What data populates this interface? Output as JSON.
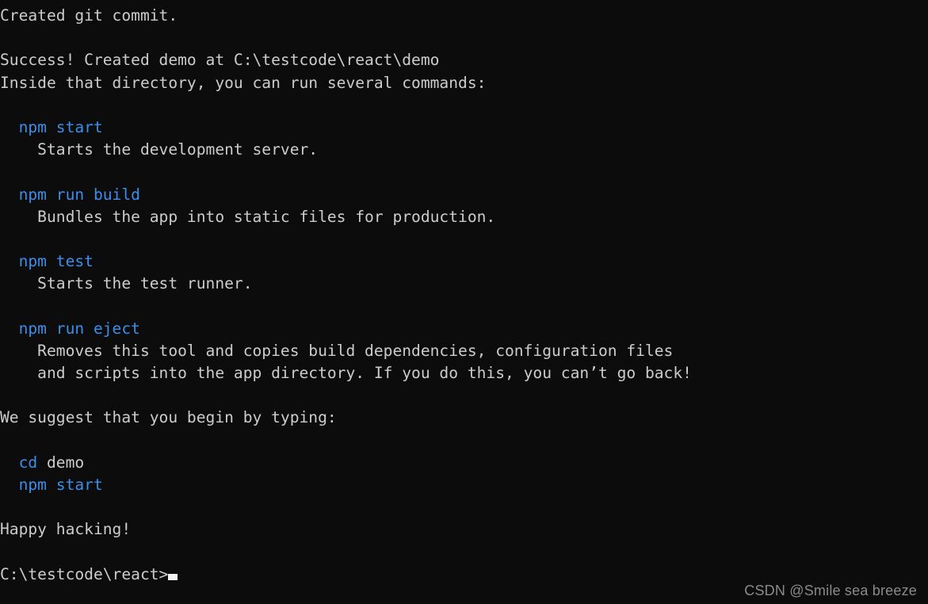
{
  "terminal": {
    "background_color": "#0c0c0c",
    "text_color": "#cccccc",
    "command_color": "#3b8eea",
    "cursor": "▃",
    "lines": [
      {
        "id": "line-created-git-commit",
        "segments": [
          {
            "kind": "out",
            "text": "Created git commit."
          }
        ]
      },
      {
        "id": "line-blank-1",
        "segments": [
          {
            "kind": "out",
            "text": ""
          }
        ]
      },
      {
        "id": "line-success-created",
        "segments": [
          {
            "kind": "out",
            "text": "Success! Created demo at C:\\testcode\\react\\demo"
          }
        ]
      },
      {
        "id": "line-inside-directory",
        "segments": [
          {
            "kind": "out",
            "text": "Inside that directory, you can run several commands:"
          }
        ]
      },
      {
        "id": "line-blank-2",
        "segments": [
          {
            "kind": "out",
            "text": ""
          }
        ]
      },
      {
        "id": "line-cmd-npm-start",
        "segments": [
          {
            "kind": "out",
            "text": "  "
          },
          {
            "kind": "cmd",
            "text": "npm start"
          }
        ]
      },
      {
        "id": "line-desc-npm-start",
        "segments": [
          {
            "kind": "out",
            "text": "    Starts the development server."
          }
        ]
      },
      {
        "id": "line-blank-3",
        "segments": [
          {
            "kind": "out",
            "text": ""
          }
        ]
      },
      {
        "id": "line-cmd-npm-run-build",
        "segments": [
          {
            "kind": "out",
            "text": "  "
          },
          {
            "kind": "cmd",
            "text": "npm run build"
          }
        ]
      },
      {
        "id": "line-desc-npm-run-build",
        "segments": [
          {
            "kind": "out",
            "text": "    Bundles the app into static files for production."
          }
        ]
      },
      {
        "id": "line-blank-4",
        "segments": [
          {
            "kind": "out",
            "text": ""
          }
        ]
      },
      {
        "id": "line-cmd-npm-test",
        "segments": [
          {
            "kind": "out",
            "text": "  "
          },
          {
            "kind": "cmd",
            "text": "npm test"
          }
        ]
      },
      {
        "id": "line-desc-npm-test",
        "segments": [
          {
            "kind": "out",
            "text": "    Starts the test runner."
          }
        ]
      },
      {
        "id": "line-blank-5",
        "segments": [
          {
            "kind": "out",
            "text": ""
          }
        ]
      },
      {
        "id": "line-cmd-npm-run-eject",
        "segments": [
          {
            "kind": "out",
            "text": "  "
          },
          {
            "kind": "cmd",
            "text": "npm run eject"
          }
        ]
      },
      {
        "id": "line-desc-npm-run-eject-1",
        "segments": [
          {
            "kind": "out",
            "text": "    Removes this tool and copies build dependencies, configuration files"
          }
        ]
      },
      {
        "id": "line-desc-npm-run-eject-2",
        "segments": [
          {
            "kind": "out",
            "text": "    and scripts into the app directory. If you do this, you can’t go back!"
          }
        ]
      },
      {
        "id": "line-blank-6",
        "segments": [
          {
            "kind": "out",
            "text": ""
          }
        ]
      },
      {
        "id": "line-we-suggest",
        "segments": [
          {
            "kind": "out",
            "text": "We suggest that you begin by typing:"
          }
        ]
      },
      {
        "id": "line-blank-7",
        "segments": [
          {
            "kind": "out",
            "text": ""
          }
        ]
      },
      {
        "id": "line-cmd-cd-demo",
        "segments": [
          {
            "kind": "out",
            "text": "  "
          },
          {
            "kind": "cmd",
            "text": "cd"
          },
          {
            "kind": "out",
            "text": " demo"
          }
        ]
      },
      {
        "id": "line-cmd-npm-start-2",
        "segments": [
          {
            "kind": "out",
            "text": "  "
          },
          {
            "kind": "cmd",
            "text": "npm start"
          }
        ]
      },
      {
        "id": "line-blank-8",
        "segments": [
          {
            "kind": "out",
            "text": ""
          }
        ]
      },
      {
        "id": "line-happy-hacking",
        "segments": [
          {
            "kind": "out",
            "text": "Happy hacking!"
          }
        ]
      },
      {
        "id": "line-blank-9",
        "segments": [
          {
            "kind": "out",
            "text": ""
          }
        ]
      },
      {
        "id": "line-prompt",
        "segments": [
          {
            "kind": "out",
            "text": "C:\\testcode\\react>"
          },
          {
            "kind": "cursor",
            "text": ""
          }
        ]
      }
    ]
  },
  "watermark": {
    "text": "CSDN @Smile sea breeze"
  }
}
